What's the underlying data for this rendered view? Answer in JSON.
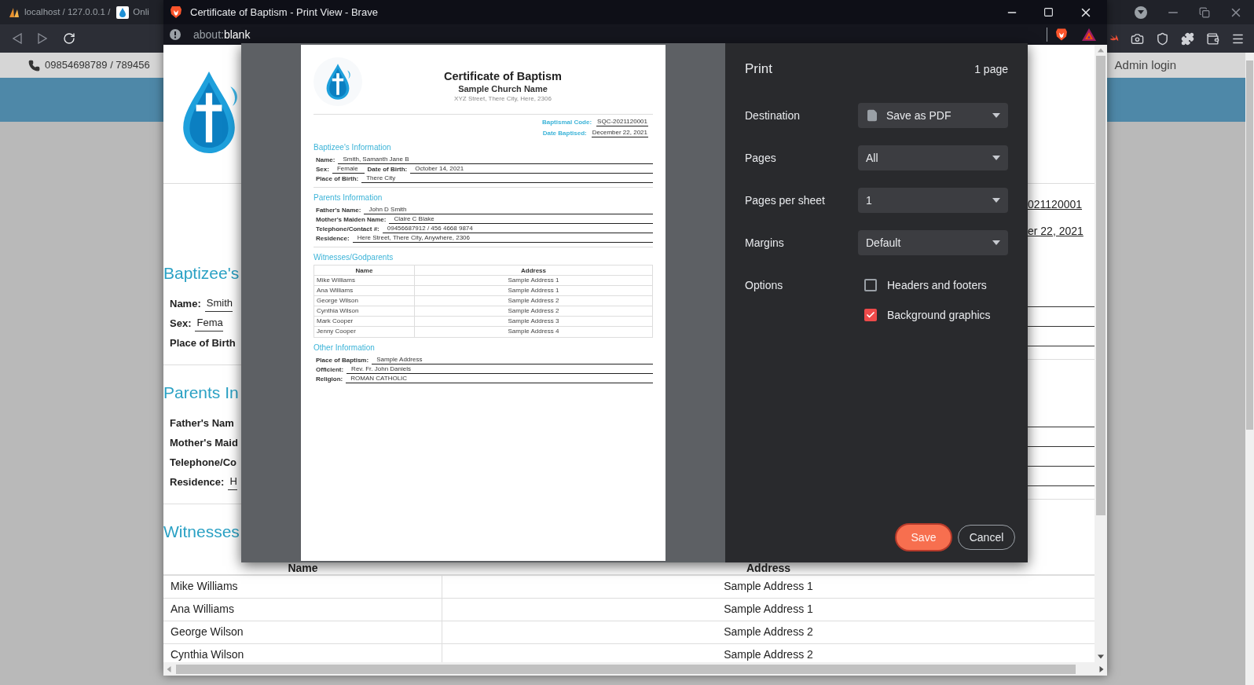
{
  "background_browser": {
    "tabs": [
      {
        "title": "localhost / 127.0.0.1 /"
      },
      {
        "title": "Onli"
      }
    ],
    "site_header": {
      "phone": "09854698789 / 789456",
      "admin_link": "Admin login"
    }
  },
  "popup": {
    "title": "Certificate of Baptism - Print View - Brave",
    "url": {
      "scheme": "about:",
      "host": "blank"
    },
    "page": {
      "left_sections": [
        {
          "heading": "Baptizee's",
          "fields": [
            {
              "label": "Name:",
              "value": "Smith"
            },
            {
              "label": "Sex:",
              "value": "Fema"
            },
            {
              "label": "Place of Birth"
            }
          ]
        },
        {
          "heading": "Parents In",
          "fields": [
            {
              "label": "Father's Nam"
            },
            {
              "label": "Mother's Maid"
            },
            {
              "label": "Telephone/Co"
            },
            {
              "label": "Residence:",
              "value": "H"
            }
          ]
        },
        {
          "heading": "Witnesses"
        }
      ],
      "right_values": [
        "021120001",
        "er 22, 2021"
      ],
      "table": {
        "columns": [
          "Name",
          "Address"
        ],
        "rows": [
          [
            "Mike Williams",
            "Sample Address 1"
          ],
          [
            "Ana Williams",
            "Sample Address 1"
          ],
          [
            "George Wilson",
            "Sample Address 2"
          ],
          [
            "Cynthia Wilson",
            "Sample Address 2"
          ]
        ]
      }
    }
  },
  "print_dialog": {
    "title": "Print",
    "page_count": "1 page",
    "settings": [
      {
        "label": "Destination",
        "kind": "destination",
        "value": "Save as PDF"
      },
      {
        "label": "Pages",
        "kind": "select",
        "value": "All"
      },
      {
        "label": "Pages per sheet",
        "kind": "select",
        "value": "1"
      },
      {
        "label": "Margins",
        "kind": "select",
        "value": "Default"
      },
      {
        "label": "Options",
        "kind": "checkboxes",
        "options": [
          {
            "label": "Headers and footers",
            "checked": false
          },
          {
            "label": "Background graphics",
            "checked": true
          }
        ]
      }
    ],
    "buttons": [
      {
        "label": "Save",
        "kind": "primary"
      },
      {
        "label": "Cancel",
        "kind": "secondary"
      }
    ],
    "preview": {
      "title": "Certificate of Baptism",
      "church": "Sample Church Name",
      "address": "XYZ Street, There City, Here, 2306",
      "codes": [
        {
          "label": "Baptismal Code:",
          "value": "SQC-2021120001"
        },
        {
          "label": "Date Baptised:",
          "value": "December 22, 2021"
        }
      ],
      "sections": [
        {
          "heading": "Baptizee's Information",
          "kind": "fields",
          "lines": [
            [
              {
                "label": "Name:",
                "value": "Smith, Samanth Jane B"
              }
            ],
            [
              {
                "label": "Sex:",
                "value": "Female"
              },
              {
                "label": "Date of Birth:",
                "value": "October 14, 2021"
              }
            ],
            [
              {
                "label": "Place of Birth:",
                "value": "There City"
              }
            ]
          ]
        },
        {
          "heading": "Parents Information",
          "kind": "fields",
          "lines": [
            [
              {
                "label": "Father's Name:",
                "value": "John D Smith"
              }
            ],
            [
              {
                "label": "Mother's Maiden Name:",
                "value": "Claire C Blake"
              }
            ],
            [
              {
                "label": "Telephone/Contact #:",
                "value": "09456687912 / 456 4668 9874"
              }
            ],
            [
              {
                "label": "Residence:",
                "value": "Here Street, There City, Anywhere, 2306"
              }
            ]
          ]
        },
        {
          "heading": "Witnesses/Godparents",
          "kind": "table",
          "columns": [
            "Name",
            "Address"
          ],
          "rows": [
            [
              "Mike Williams",
              "Sample Address 1"
            ],
            [
              "Ana Williams",
              "Sample Address 1"
            ],
            [
              "George Wilson",
              "Sample Address 2"
            ],
            [
              "Cynthia Wilson",
              "Sample Address 2"
            ],
            [
              "Mark Cooper",
              "Sample Address 3"
            ],
            [
              "Jenny Cooper",
              "Sample Address 4"
            ]
          ]
        },
        {
          "heading": "Other Information",
          "kind": "fields",
          "lines": [
            [
              {
                "label": "Place of Baptism:",
                "value": "Sample Address"
              }
            ],
            [
              {
                "label": "Officient:",
                "value": "Rev. Fr. John Daniels"
              }
            ],
            [
              {
                "label": "Religion:",
                "value": "ROMAN CATHOLIC"
              }
            ]
          ]
        }
      ]
    }
  }
}
